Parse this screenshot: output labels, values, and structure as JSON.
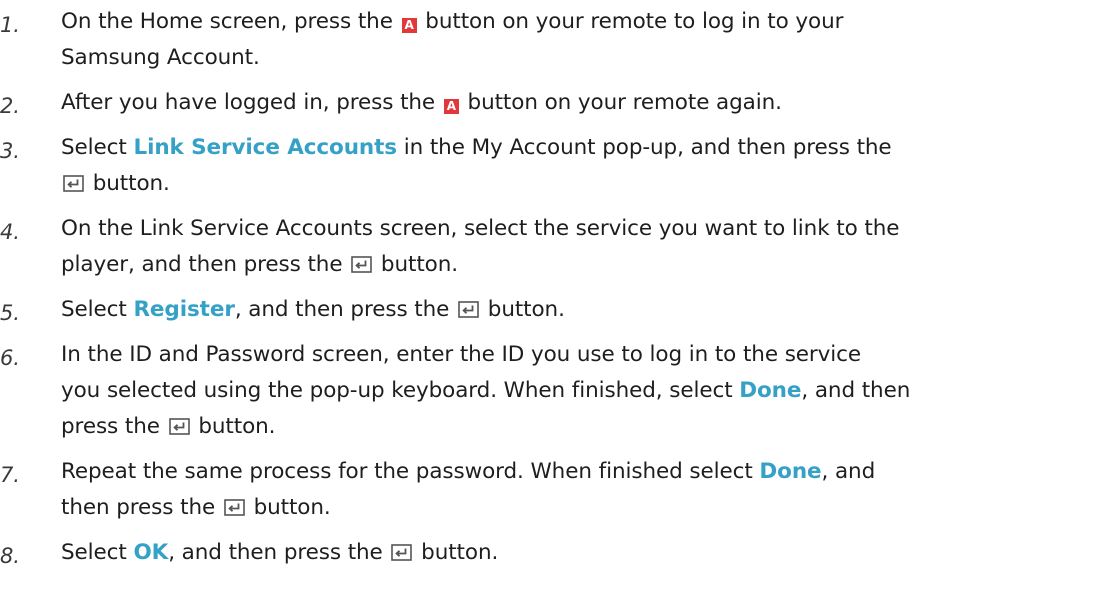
{
  "steps": [
    {
      "number": "1.",
      "lines": [
        [
          {
            "type": "text",
            "value": "On the Home screen, press the "
          },
          {
            "type": "icon",
            "icon": "red-a-button-icon",
            "glyph": "A",
            "color": "#e2383b"
          },
          {
            "type": "text",
            "value": " button on your remote to log in to your"
          }
        ],
        [
          {
            "type": "text",
            "value": "Samsung Account."
          }
        ]
      ]
    },
    {
      "number": "2.",
      "lines": [
        [
          {
            "type": "text",
            "value": "After you have logged in, press the "
          },
          {
            "type": "icon",
            "icon": "red-a-button-icon",
            "glyph": "A",
            "color": "#e2383b"
          },
          {
            "type": "text",
            "value": " button on your remote again."
          }
        ]
      ]
    },
    {
      "number": "3.",
      "lines": [
        [
          {
            "type": "text",
            "value": "Select "
          },
          {
            "type": "kw",
            "value": "Link Service Accounts"
          },
          {
            "type": "text",
            "value": " in the My Account pop-up, and then press the"
          }
        ],
        [
          {
            "type": "icon",
            "icon": "enter-button-icon"
          },
          {
            "type": "text",
            "value": " button."
          }
        ]
      ]
    },
    {
      "number": "4.",
      "lines": [
        [
          {
            "type": "text",
            "value": "On the Link Service Accounts screen, select the service you want to link to the"
          }
        ],
        [
          {
            "type": "text",
            "value": "player, and then press the "
          },
          {
            "type": "icon",
            "icon": "enter-button-icon"
          },
          {
            "type": "text",
            "value": " button."
          }
        ]
      ]
    },
    {
      "number": "5.",
      "lines": [
        [
          {
            "type": "text",
            "value": "Select "
          },
          {
            "type": "kw",
            "value": "Register"
          },
          {
            "type": "text",
            "value": ", and then press the "
          },
          {
            "type": "icon",
            "icon": "enter-button-icon"
          },
          {
            "type": "text",
            "value": " button."
          }
        ]
      ]
    },
    {
      "number": "6.",
      "lines": [
        [
          {
            "type": "text",
            "value": "In the ID and Password screen, enter the ID you use to log in to the service"
          }
        ],
        [
          {
            "type": "text",
            "value": "you selected using the pop-up keyboard. When finished, select "
          },
          {
            "type": "kw",
            "value": "Done"
          },
          {
            "type": "text",
            "value": ", and then"
          }
        ],
        [
          {
            "type": "text",
            "value": "press the "
          },
          {
            "type": "icon",
            "icon": "enter-button-icon"
          },
          {
            "type": "text",
            "value": " button."
          }
        ]
      ]
    },
    {
      "number": "7.",
      "lines": [
        [
          {
            "type": "text",
            "value": "Repeat the same process for the password. When finished select "
          },
          {
            "type": "kw",
            "value": "Done"
          },
          {
            "type": "text",
            "value": ", and"
          }
        ],
        [
          {
            "type": "text",
            "value": "then press the "
          },
          {
            "type": "icon",
            "icon": "enter-button-icon"
          },
          {
            "type": "text",
            "value": " button."
          }
        ]
      ]
    },
    {
      "number": "8.",
      "lines": [
        [
          {
            "type": "text",
            "value": "Select "
          },
          {
            "type": "kw",
            "value": "OK"
          },
          {
            "type": "text",
            "value": ", and then press the "
          },
          {
            "type": "icon",
            "icon": "enter-button-icon"
          },
          {
            "type": "text",
            "value": " button."
          }
        ]
      ]
    }
  ]
}
